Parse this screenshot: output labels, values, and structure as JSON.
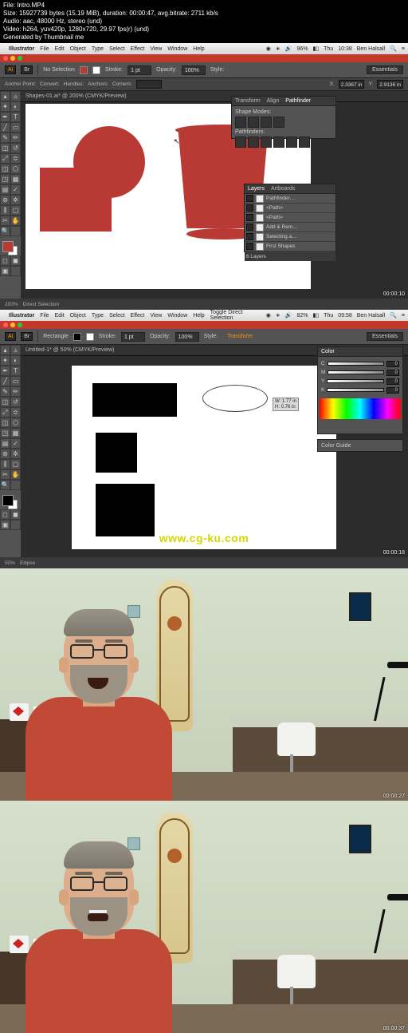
{
  "meta": {
    "file": "File: Intro.MP4",
    "size": "Size: 15927739 bytes (15.19 MiB), duration: 00:00:47, avg.bitrate: 2711 kb/s",
    "audio": "Audio: aac, 48000 Hz, stereo (und)",
    "video": "Video: h264, yuv420p, 1280x720, 29.97 fps(r) (und)",
    "gen": "Generated by Thumbnail me"
  },
  "mac1": {
    "app": "Illustrator",
    "menus": [
      "File",
      "Edit",
      "Object",
      "Type",
      "Select",
      "Effect",
      "View",
      "Window",
      "Help"
    ],
    "battery": "96%",
    "day": "Thu",
    "time": "10:38",
    "user": "Ben Halsall"
  },
  "mac2": {
    "app": "Illustrator",
    "centre": "Toggle Direct Selection",
    "menus": [
      "File",
      "Edit",
      "Object",
      "Type",
      "Select",
      "Effect",
      "View",
      "Window",
      "Help"
    ],
    "battery": "82%",
    "day": "Thu",
    "time": "09:58",
    "user": "Ben Halsall"
  },
  "opt1": {
    "essentials": "Essentials",
    "noSel": "No Selection",
    "fill": "Fill:",
    "stroke": "Stroke:",
    "strokeWt": "1 pt",
    "opacity": "Opacity:",
    "opVal": "100%",
    "style": "Style:"
  },
  "opt2": {
    "essentials": "Essentials",
    "rect": "Rectangle",
    "fill": "Fill:",
    "stroke": "Stroke:",
    "strokeWt": "1 pt",
    "opacity": "Opacity:",
    "opVal": "100%",
    "style": "Style:",
    "transform": "Transform"
  },
  "sub1": {
    "anchor": "Anchor Point:",
    "convert": "Convert:",
    "handles": "Handles:",
    "anchors": "Anchors:",
    "corners": "Corners:",
    "x": "X:",
    "xVal": "2.3367 in",
    "y": "Y:",
    "yVal": "2.9136 in"
  },
  "doc1": {
    "tab": "Shapes-01.ai* @ 200% (CMYK/Preview)"
  },
  "doc2": {
    "tab": "Untitled-1* @ 50% (CMYK/Preview)"
  },
  "pathfinder": {
    "tabs": [
      "Transform",
      "Align",
      "Pathfinder"
    ],
    "l1": "Shape Modes:",
    "l2": "Pathfinders:"
  },
  "layers": {
    "tabs": [
      "Layers",
      "Artboards"
    ],
    "items": [
      "Pathfinder…",
      "<Path>",
      "<Path>",
      "Add & Rem…",
      "Selecting a…",
      "First Shapes"
    ],
    "footer": "6 Layers"
  },
  "color": {
    "tab": "Color",
    "ch": [
      "C",
      "M",
      "Y",
      "K"
    ],
    "vals": [
      "0",
      "0",
      "0",
      "0"
    ],
    "guide": "Color Guide"
  },
  "dim": {
    "w": "W: 1.77 in",
    "h": "H: 0.76 in"
  },
  "status1": {
    "zoom": "200%",
    "tool": "Direct Selection",
    "ts": "00:00:10"
  },
  "status2": {
    "zoom": "50%",
    "tool": "Ellipse",
    "ts": "00:00:18"
  },
  "watermark": "www.cg-ku.com",
  "photo": {
    "ts1": "00:00:27",
    "ts2": "00:00:37"
  },
  "colors": {
    "red": "#b93a34",
    "orange": "#c14a36"
  }
}
